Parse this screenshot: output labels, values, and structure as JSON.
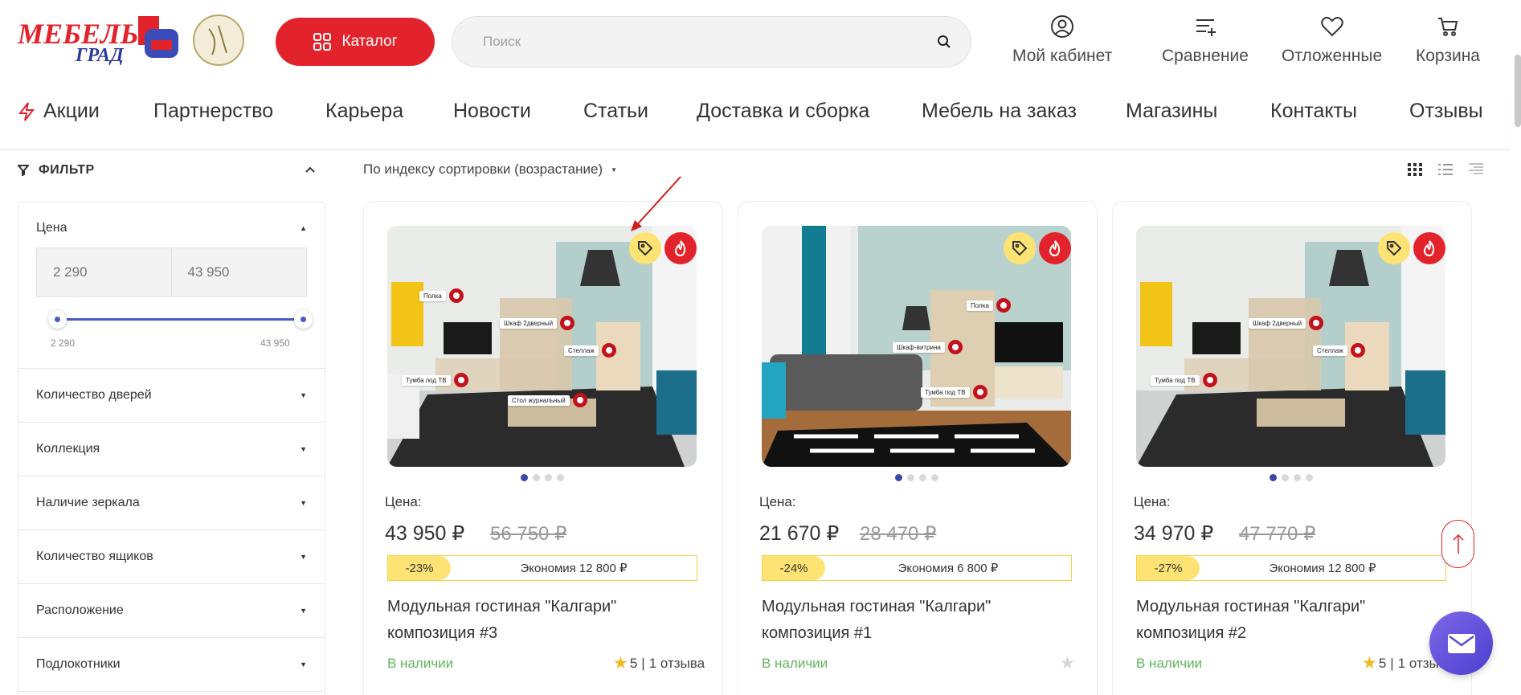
{
  "header": {
    "catalog_label": "Каталог",
    "search_placeholder": "Поиск",
    "actions": [
      {
        "label": "Мой кабинет",
        "icon": "user-icon"
      },
      {
        "label": "Сравнение",
        "icon": "compare-icon"
      },
      {
        "label": "Отложенные",
        "icon": "heart-icon"
      },
      {
        "label": "Корзина",
        "icon": "cart-icon"
      }
    ],
    "brand_color": "#e3232c"
  },
  "nav": {
    "items": [
      "Акции",
      "Партнерство",
      "Карьера",
      "Новости",
      "Статьи",
      "Доставка и сборка",
      "Мебель на заказ",
      "Магазины",
      "Контакты",
      "Отзывы"
    ]
  },
  "filter": {
    "title": "ФИЛЬТР",
    "price": {
      "label": "Цена",
      "min_placeholder": "2 290",
      "max_placeholder": "43 950",
      "min_label": "2 290",
      "max_label": "43 950"
    },
    "sections": [
      "Количество дверей",
      "Коллекция",
      "Наличие зеркала",
      "Количество ящиков",
      "Расположение",
      "Подлокотники"
    ]
  },
  "sort": {
    "label": "По индексу сортировки (возрастание)"
  },
  "products": [
    {
      "price_label": "Цена:",
      "price": "43 950 ₽",
      "old_price": "56 750 ₽",
      "discount": "-23%",
      "savings": "Экономия 12 800 ₽",
      "name": "Модульная гостиная \"Калгари\" композиция #3",
      "stock": "В наличии",
      "rating": "5",
      "reviews": "1 отзыва",
      "hotspots": [
        "Полка",
        "Шкаф 2дверный",
        "Стеллаж",
        "Тумба под ТВ",
        "Стол журнальный"
      ]
    },
    {
      "price_label": "Цена:",
      "price": "21 670 ₽",
      "old_price": "28 470 ₽",
      "discount": "-24%",
      "savings": "Экономия 6 800 ₽",
      "name": "Модульная гостиная \"Калгари\" композиция #1",
      "stock": "В наличии",
      "rating": "",
      "reviews": "",
      "hotspots": [
        "Полка",
        "Шкаф-витрина",
        "Тумба под ТВ"
      ]
    },
    {
      "price_label": "Цена:",
      "price": "34 970 ₽",
      "old_price": "47 770 ₽",
      "discount": "-27%",
      "savings": "Экономия 12 800 ₽",
      "name": "Модульная гостиная \"Калгари\" композиция #2",
      "stock": "В наличии",
      "rating": "5",
      "reviews": "1 отзыва",
      "hotspots": [
        "Шкаф 2дверный",
        "Стеллаж",
        "Тумба под ТВ"
      ]
    }
  ]
}
